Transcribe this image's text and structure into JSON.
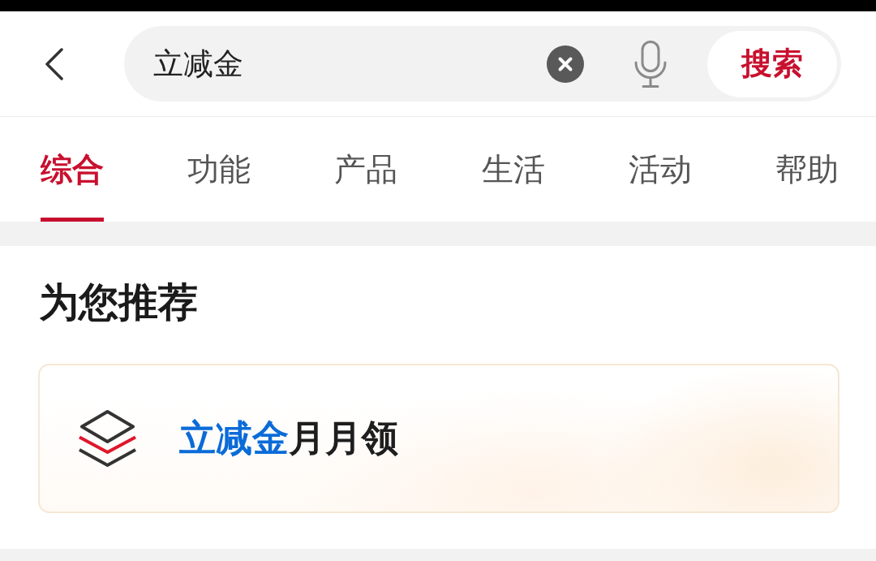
{
  "header": {
    "search": {
      "value": "立减金"
    },
    "search_button": "搜索"
  },
  "tabs": [
    {
      "label": "综合",
      "selected": true
    },
    {
      "label": "功能",
      "selected": false
    },
    {
      "label": "产品",
      "selected": false
    },
    {
      "label": "生活",
      "selected": false
    },
    {
      "label": "活动",
      "selected": false
    },
    {
      "label": "帮助",
      "selected": false
    }
  ],
  "recommend": {
    "title": "为您推荐",
    "cards": [
      {
        "title_parts": [
          {
            "text": "立减金",
            "highlight": true
          },
          {
            "text": "月月领",
            "highlight": false
          }
        ]
      }
    ]
  }
}
